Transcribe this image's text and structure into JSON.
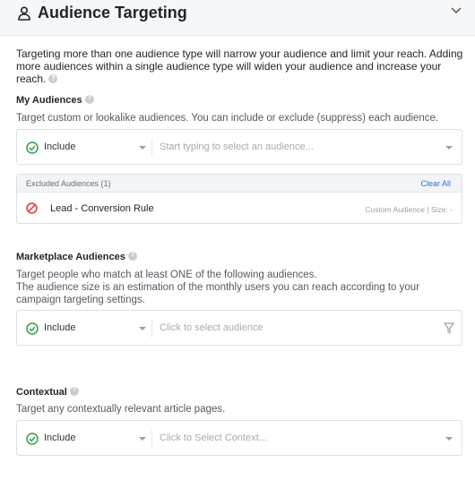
{
  "header": {
    "title": "Audience Targeting",
    "icon": "person-icon",
    "collapse_icon": "chevron-down-icon"
  },
  "intro": {
    "text": "Targeting more than one audience type will narrow your audience and limit your reach. Adding more audiences within a single audience type will widen your audience and increase your reach."
  },
  "my_audiences": {
    "title": "My Audiences",
    "description": "Target custom or lookalike audiences. You can include or exclude (suppress) each audience.",
    "include_label": "Include",
    "placeholder": "Start typing to select an audience...",
    "excluded": {
      "header": "Excluded Audiences (1)",
      "clear_label": "Clear All",
      "items": [
        {
          "name": "Lead - Conversion Rule",
          "meta": "Custom Audience | Size: -"
        }
      ]
    }
  },
  "marketplace": {
    "title": "Marketplace Audiences",
    "description_1": "Target people who match at least ONE of the following audiences.",
    "description_2": "The audience size is an estimation of the monthly users you can reach according to your campaign targeting settings.",
    "include_label": "Include",
    "placeholder": "Click to select audience"
  },
  "contextual": {
    "title": "Contextual",
    "description": "Target any contextually relevant article pages.",
    "include_label": "Include",
    "placeholder": "Click to Select Context..."
  },
  "colors": {
    "include_green": "#2ea043",
    "exclude_red": "#e0413c",
    "link_blue": "#2f6fdc"
  }
}
